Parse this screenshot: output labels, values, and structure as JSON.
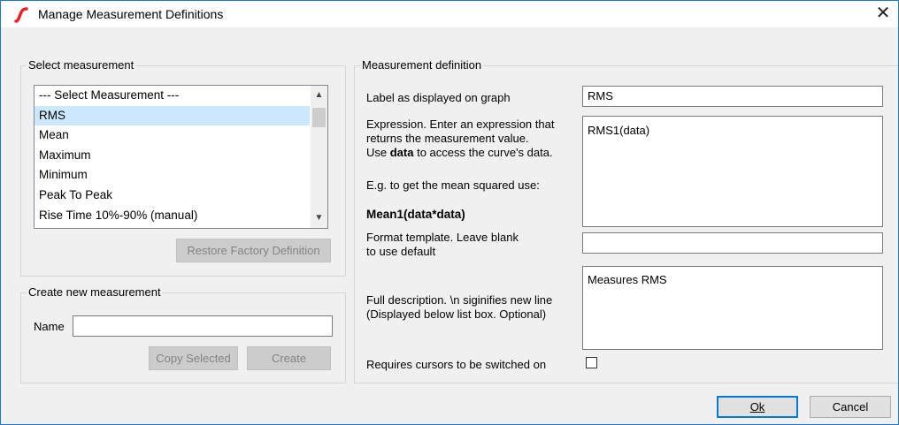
{
  "window": {
    "title": "Manage Measurement Definitions",
    "close_glyph": "✕"
  },
  "select_group": {
    "title": "Select measurement",
    "items": [
      {
        "label": "--- Select Measurement ---"
      },
      {
        "label": "RMS"
      },
      {
        "label": "Mean"
      },
      {
        "label": "Maximum"
      },
      {
        "label": "Minimum"
      },
      {
        "label": "Peak To Peak"
      },
      {
        "label": "Rise Time 10%-90% (manual)"
      }
    ],
    "selected_index": 1,
    "scroll_up": "▲",
    "scroll_down": "▼",
    "restore_button": "Restore Factory Definition"
  },
  "create_group": {
    "title": "Create new measurement",
    "name_label": "Name",
    "name_value": "",
    "copy_button": "Copy Selected",
    "create_button": "Create"
  },
  "definition_group": {
    "title": "Measurement definition",
    "graph_label": "Label as displayed on graph",
    "graph_value": "RMS",
    "expr_line1": "Expression. Enter an expression that",
    "expr_line2": "returns the measurement value.",
    "expr_line3_pre": "Use ",
    "expr_line3_bold": "data",
    "expr_line3_post": " to access the curve's data.",
    "expr_example": "E.g. to get the mean squared use:",
    "expr_example_code": "Mean1(data*data)",
    "expr_value": "RMS1(data)",
    "format_line1": "Format template. Leave blank",
    "format_line2": "to use default",
    "format_value": "",
    "desc_line1": "Full description. \\n siginifies new line",
    "desc_line2": "(Displayed below list box. Optional)",
    "desc_value": "Measures RMS",
    "cursor_label": "Requires cursors to be switched on",
    "cursor_checked": false
  },
  "footer": {
    "ok_button": "Ok",
    "cancel_button": "Cancel"
  }
}
